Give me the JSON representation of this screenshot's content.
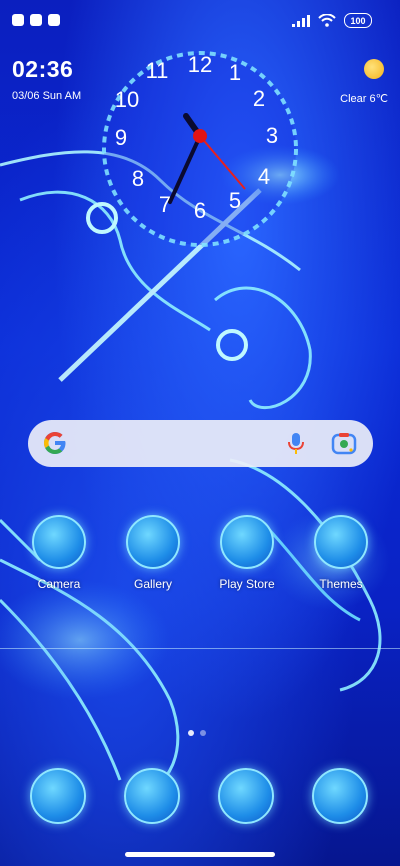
{
  "status_bar": {
    "icons_left": [
      "notification-icon-1",
      "notification-icon-2",
      "notification-icon-3"
    ],
    "battery": "100"
  },
  "clock_widget": {
    "time": "02:36",
    "date": "03/06 Sun AM",
    "numbers": [
      "12",
      "1",
      "2",
      "3",
      "4",
      "5",
      "6",
      "7",
      "8",
      "9",
      "10",
      "11"
    ]
  },
  "weather_widget": {
    "summary": "Clear 6℃",
    "icon": "sun-icon"
  },
  "search_bar": {
    "logo": "google-g-icon",
    "mic": "voice-search-icon",
    "lens": "lens-camera-icon"
  },
  "apps": [
    {
      "label": "Camera",
      "icon": "camera-icon"
    },
    {
      "label": "Gallery",
      "icon": "gallery-icon"
    },
    {
      "label": "Play Store",
      "icon": "play-store-icon"
    },
    {
      "label": "Themes",
      "icon": "themes-icon"
    }
  ],
  "dock": [
    {
      "icon": "phone-icon"
    },
    {
      "icon": "messages-icon"
    },
    {
      "icon": "browser-icon"
    },
    {
      "icon": "settings-icon"
    }
  ],
  "pager": {
    "pages": 2,
    "current": 1
  }
}
